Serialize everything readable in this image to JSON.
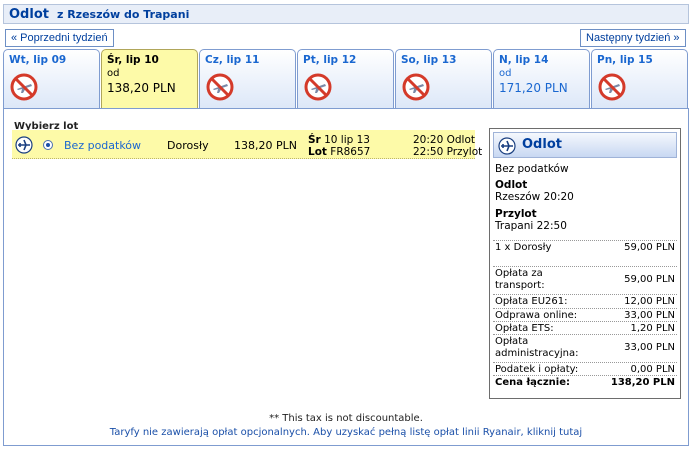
{
  "header": {
    "title": "Odlot",
    "route": "z Rzeszów do Trapani"
  },
  "nav": {
    "prev_label": "« Poprzedni tydzień",
    "next_label": "Następny tydzień »"
  },
  "tabs": [
    {
      "day": "Wt, lip 09",
      "od": "",
      "price": ""
    },
    {
      "day": "Śr, lip 10",
      "od": "od",
      "price": "138,20 PLN"
    },
    {
      "day": "Cz, lip 11",
      "od": "",
      "price": ""
    },
    {
      "day": "Pt, lip 12",
      "od": "",
      "price": ""
    },
    {
      "day": "So, lip 13",
      "od": "",
      "price": ""
    },
    {
      "day": "N, lip 14",
      "od": "od",
      "price": "171,20 PLN"
    },
    {
      "day": "Pn, lip 15",
      "od": "",
      "price": ""
    }
  ],
  "flights": {
    "heading": "Wybierz lot",
    "row": {
      "fare": "Bez podatków",
      "passenger": "Dorosły",
      "price": "138,20 PLN",
      "date_prefix": "Śr",
      "date": "10 lip 13",
      "flight_prefix": "Lot",
      "flight_no": "FR8657",
      "departure": "20:20 Odlot",
      "arrival": "22:50 Przylot"
    }
  },
  "summary": {
    "title": "Odlot",
    "fare": "Bez podatków",
    "dep_label": "Odlot",
    "dep_value": "Rzeszów 20:20",
    "arr_label": "Przylot",
    "arr_value": "Trapani 22:50",
    "fees": [
      {
        "label": "1 x Dorosły",
        "value": "59,00 PLN"
      },
      {
        "label": "Opłata za transport:",
        "value": "59,00 PLN"
      },
      {
        "label": "Opłata EU261:",
        "value": "12,00 PLN"
      },
      {
        "label": "Odprawa online:",
        "value": "33,00 PLN"
      },
      {
        "label": "Opłata ETS:",
        "value": "1,20 PLN"
      },
      {
        "label": "Opłata administracyjna:",
        "value": "33,00 PLN"
      },
      {
        "label": "Podatek i opłaty:",
        "value": "0,00 PLN"
      },
      {
        "label": "Cena łącznie:",
        "value": "138,20 PLN"
      }
    ]
  },
  "footer": {
    "note": "** This tax is not discountable.",
    "link": "Taryfy nie zawierają opłat opcjonalnych. Aby uzyskać pełną listę opłat linii Ryanair, kliknij tutaj"
  },
  "colors": {
    "brand_blue": "#003f9e",
    "selected_yellow": "#fdfaa8",
    "link_blue": "#1a67d0"
  }
}
